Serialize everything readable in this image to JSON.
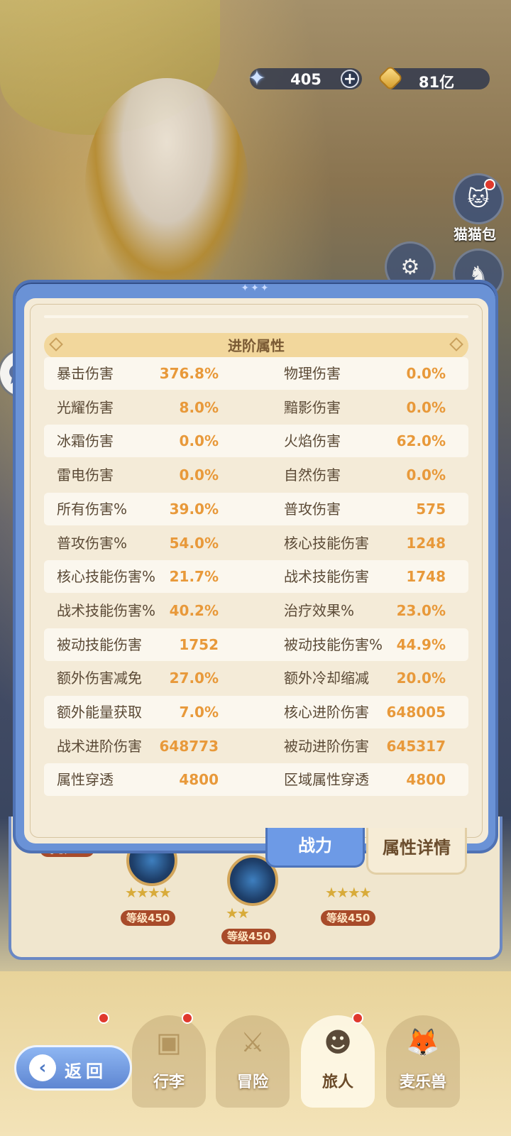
{
  "currency": {
    "gems": "405",
    "gold": "81亿",
    "add_label": "+"
  },
  "side_buttons": {
    "cat_bag_label": "猫猫包"
  },
  "panel": {
    "section_title": "进阶属性",
    "stats": [
      {
        "left_name": "暴击伤害",
        "left_value": "376.8%",
        "right_name": "物理伤害",
        "right_value": "0.0%"
      },
      {
        "left_name": "光耀伤害",
        "left_value": "8.0%",
        "right_name": "黯影伤害",
        "right_value": "0.0%"
      },
      {
        "left_name": "冰霜伤害",
        "left_value": "0.0%",
        "right_name": "火焰伤害",
        "right_value": "62.0%"
      },
      {
        "left_name": "雷电伤害",
        "left_value": "0.0%",
        "right_name": "自然伤害",
        "right_value": "0.0%"
      },
      {
        "left_name": "所有伤害%",
        "left_value": "39.0%",
        "right_name": "普攻伤害",
        "right_value": "575"
      },
      {
        "left_name": "普攻伤害%",
        "left_value": "54.0%",
        "right_name": "核心技能伤害",
        "right_value": "1248"
      },
      {
        "left_name": "核心技能伤害%",
        "left_value": "21.7%",
        "right_name": "战术技能伤害",
        "right_value": "1748"
      },
      {
        "left_name": "战术技能伤害%",
        "left_value": "40.2%",
        "right_name": "治疗效果%",
        "right_value": "23.0%"
      },
      {
        "left_name": "被动技能伤害",
        "left_value": "1752",
        "right_name": "被动技能伤害%",
        "right_value": "44.9%"
      },
      {
        "left_name": "额外伤害减免",
        "left_value": "27.0%",
        "right_name": "额外冷却缩减",
        "right_value": "20.0%"
      },
      {
        "left_name": "额外能量获取",
        "left_value": "7.0%",
        "right_name": "核心进阶伤害",
        "right_value": "648005"
      },
      {
        "left_name": "战术进阶伤害",
        "left_value": "648773",
        "right_name": "被动进阶伤害",
        "right_value": "645317"
      },
      {
        "left_name": "属性穿透",
        "left_value": "4800",
        "right_name": "区域属性穿透",
        "right_value": "4800"
      }
    ]
  },
  "tabs": {
    "power": "战力",
    "details": "属性详情"
  },
  "skills": {
    "level_label": "等级450"
  },
  "nav": {
    "items": [
      "行李",
      "冒险",
      "旅人",
      "麦乐兽"
    ],
    "back": "返回"
  },
  "colors": {
    "panel_blue": "#6a92d6",
    "value_orange": "#e8993a",
    "section_gold": "#f2d79c"
  }
}
